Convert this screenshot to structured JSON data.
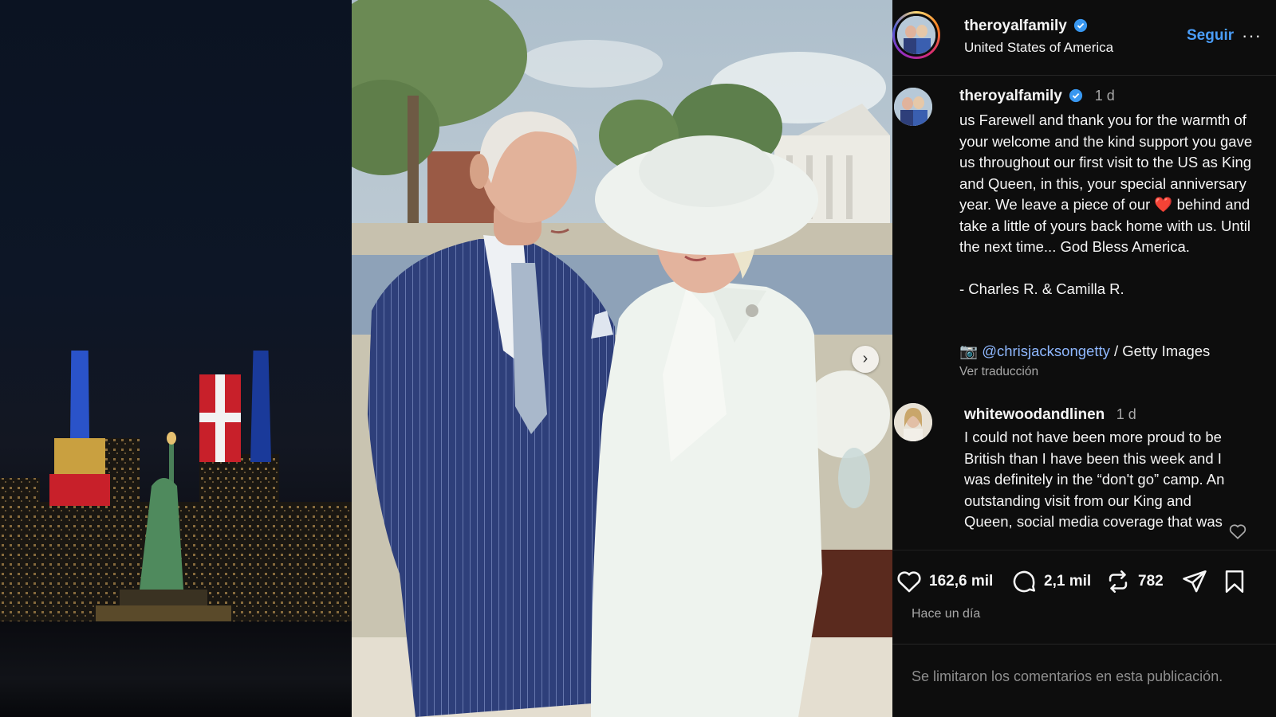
{
  "header": {
    "username": "theroyalfamily",
    "location": "United States of America",
    "follow_label": "Seguir",
    "more_label": "···"
  },
  "caption": {
    "username": "theroyalfamily",
    "time": "1 d",
    "line1": "us Farewell and thank you for the warmth of your welcome and the kind support you gave us throughout our first visit to the US as King and Queen, in this, your special anniversary year. We leave a piece of our",
    "heart": "❤️",
    "line2": " behind and take a little of yours back home with us. Until the next time... God Bless America.",
    "signature": "- Charles R. & Camilla R.",
    "credit_icon": "📷",
    "credit_mention": "@chrisjacksongetty",
    "credit_suffix": " / Getty Images",
    "translate_label": "Ver traducción"
  },
  "comment": {
    "username": "whitewoodandlinen",
    "time": "1 d",
    "text": "I could not have been more proud to be British than I have been this week and I was definitely in the “don't go” camp. An outstanding visit from our King and Queen, social media coverage that was"
  },
  "actions": {
    "likes": "162,6 mil",
    "comments": "2,1 mil",
    "reposts": "782"
  },
  "posted_label": "Hace un día",
  "comments_limited": "Se limitaron los comentarios en esta publicación.",
  "carousel": {
    "current": 1,
    "total": 2
  },
  "icons": [
    "verified-badge-icon",
    "heart-icon",
    "comment-icon",
    "repost-icon",
    "share-icon",
    "bookmark-icon",
    "chevron-right-icon",
    "camera-icon"
  ],
  "colors": {
    "panel_bg": "#0d0d0d",
    "follow": "#4a9df8",
    "verified": "#3897f0",
    "mention": "#8fb8ff",
    "muted": "#a8a8a8"
  }
}
